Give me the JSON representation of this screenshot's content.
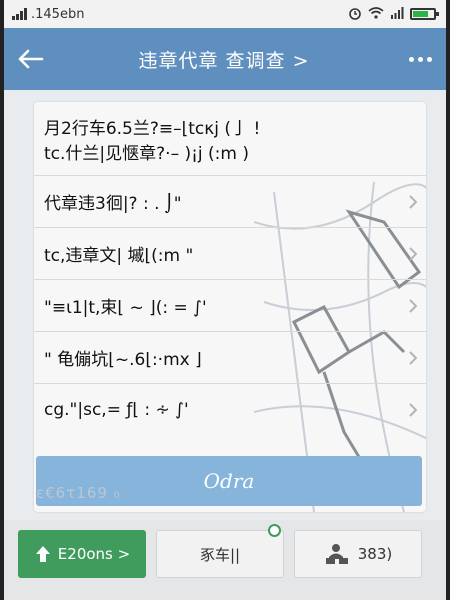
{
  "status_bar": {
    "carrier": ".145ebn",
    "icons": [
      "signal-icon",
      "alarm-icon",
      "wifi-icon",
      "battery-icon"
    ],
    "battery_level": 0.75
  },
  "header": {
    "title": "违章代章 查调查 >",
    "back_icon": "arrow-left-icon",
    "more_icon": "more-dots-icon"
  },
  "list": {
    "items": [
      {
        "line1": "月2行车6.5兰?≡–⌊tcκj (亅 !",
        "line2": "tc.什兰|见惬章?·– )¡j (:m )"
      },
      {
        "line1": "代章违3徊|? : . ⌡\""
      },
      {
        "line1": "tc,违章文| 墄⌊(:m \""
      },
      {
        "line1": "\"≡ι1|t,束⌊ ~ ⌋(: = ∫'"
      },
      {
        "line1": "\" 龟傰坑⌊~.6⌊:·mx ⌋"
      },
      {
        "line1": "cg.\"|sc,= ƒ⌊ : ∻ ∫'"
      }
    ]
  },
  "action_button": {
    "label": "Odra"
  },
  "ghost_text": "ε€6τ169 ₀",
  "bottom_tabs": {
    "tab1": {
      "label": "E20ons >",
      "icon": "arrow-up-icon"
    },
    "tab2": {
      "label": "豖车||"
    },
    "tab3": {
      "label": "383)",
      "icon": "delivery-person-icon"
    }
  },
  "colors": {
    "header_bg": "#5f8fbe",
    "action_btn": "#86b4da",
    "tab_active": "#3f9c5d"
  }
}
